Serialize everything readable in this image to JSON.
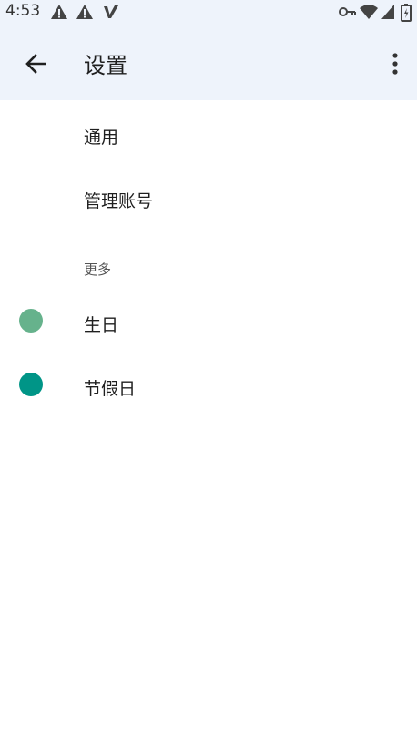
{
  "status_bar": {
    "time": "4:53",
    "icons": [
      "alert-icon",
      "alert-icon",
      "v-logo-icon",
      "vpn-key-icon",
      "wifi-icon",
      "signal-icon",
      "battery-icon"
    ]
  },
  "toolbar": {
    "title": "设置",
    "back_icon": "arrow-back-icon",
    "more_icon": "more-vert-icon"
  },
  "settings": [
    {
      "label": "通用"
    },
    {
      "label": "管理账号"
    }
  ],
  "more_section": {
    "header": "更多",
    "items": [
      {
        "label": "生日",
        "color": "#66b28c"
      },
      {
        "label": "节假日",
        "color": "#009587"
      }
    ]
  },
  "colors": {
    "header_bg": "#eef3fb",
    "birthday": "#66b28c",
    "holidays": "#009587"
  }
}
